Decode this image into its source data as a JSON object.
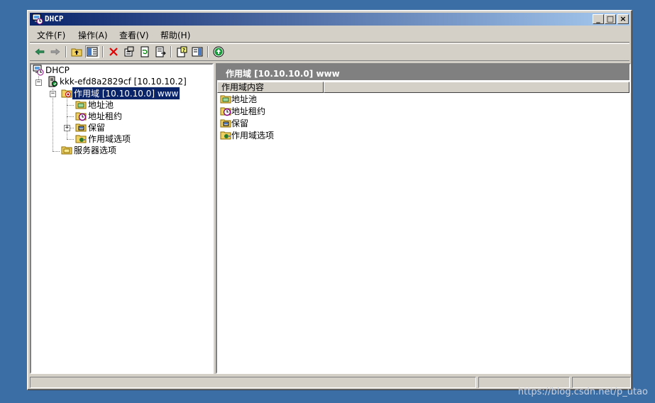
{
  "window": {
    "title": "DHCP"
  },
  "menu": [
    {
      "label": "文件(F)"
    },
    {
      "label": "操作(A)"
    },
    {
      "label": "查看(V)"
    },
    {
      "label": "帮助(H)"
    }
  ],
  "toolbar": {
    "icons": [
      "back-icon",
      "forward-icon",
      "up-folder-icon",
      "show-hide-tree-icon",
      "delete-icon",
      "properties-icon",
      "refresh-icon",
      "export-list-icon",
      "help-icon",
      "show-hide-action-pane-icon",
      "activate-icon"
    ]
  },
  "tree": {
    "root": "DHCP",
    "server": "kkk-efd8a2829cf [10.10.10.2]",
    "scope": "作用域 [10.10.10.0] www",
    "scope_children": [
      "地址池",
      "地址租约",
      "保留",
      "作用域选项"
    ],
    "server_options": "服务器选项"
  },
  "details": {
    "header": "作用域 [10.10.10.0] www",
    "column": "作用域内容",
    "items": [
      "地址池",
      "地址租约",
      "保留",
      "作用域选项"
    ]
  },
  "watermark": "https://blog.csdn.net/p_utao",
  "colors": {
    "titlebar": "#0a246a",
    "desktop": "#3a6ea5",
    "selection": "#0a246a"
  }
}
